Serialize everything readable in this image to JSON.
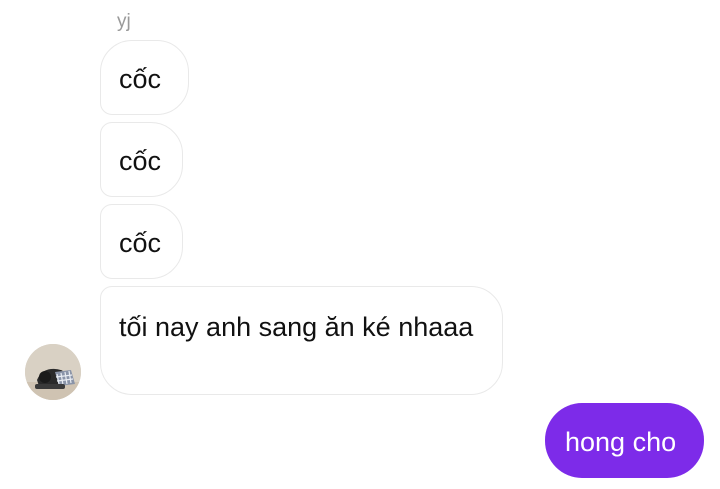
{
  "conversation": {
    "sender_name": "yj",
    "incoming": [
      {
        "text": "cốc"
      },
      {
        "text": "cốc"
      },
      {
        "text": "cốc"
      },
      {
        "text": "tối nay anh sang ăn ké nhaaa"
      }
    ],
    "outgoing": [
      {
        "text": "hong cho"
      }
    ]
  },
  "colors": {
    "outgoing_bubble": "#7d2be9",
    "incoming_border": "#e9e9e9",
    "sender_name": "#9a9a9a"
  },
  "icons": {
    "avatar": "user-avatar-photo"
  }
}
